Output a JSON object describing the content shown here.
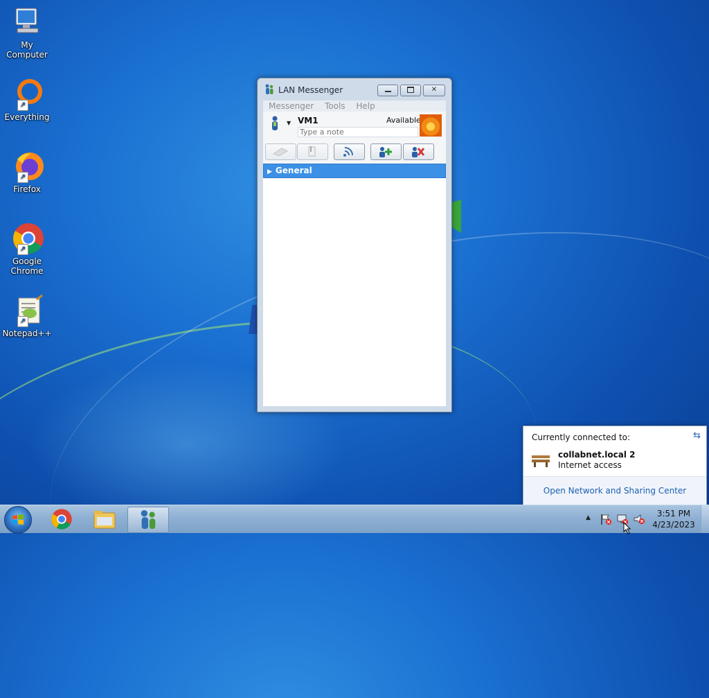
{
  "desktop": {
    "icons": [
      {
        "label": "My Computer"
      },
      {
        "label": "Everything"
      },
      {
        "label": "Firefox"
      },
      {
        "label_line1": "Google",
        "label_line2": "Chrome"
      },
      {
        "label": "Notepad++"
      }
    ]
  },
  "messenger": {
    "title": "LAN Messenger",
    "menu": [
      "Messenger",
      "Tools",
      "Help"
    ],
    "user_name": "VM1",
    "status": "Available",
    "note_placeholder": "Type a note",
    "groups": [
      {
        "name": "General"
      }
    ]
  },
  "network_popup": {
    "header": "Currently connected to:",
    "network_name": "collabnet.local  2",
    "network_status": "Internet access",
    "link": "Open Network and Sharing Center"
  },
  "taskbar": {
    "time": "3:51 PM",
    "date": "4/23/2023"
  }
}
